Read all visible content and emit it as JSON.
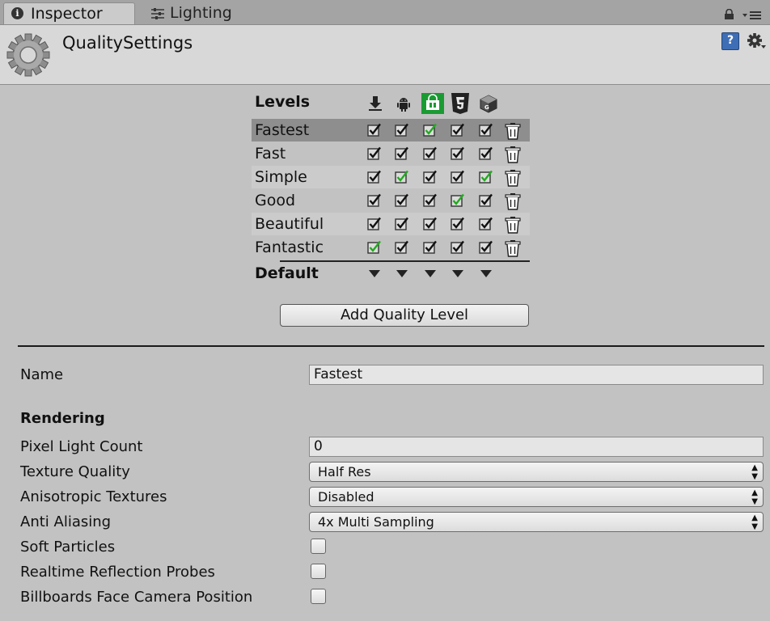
{
  "tabs": {
    "inspector": "Inspector",
    "lighting": "Lighting"
  },
  "header": {
    "title": "QualitySettings",
    "help_glyph": "?"
  },
  "levels": {
    "title": "Levels",
    "platform_icons": [
      "standalone-download-icon",
      "android-icon",
      "windows-store-icon",
      "html5-icon",
      "webgl-cube-icon"
    ],
    "rows": [
      {
        "name": "Fastest",
        "checks": [
          true,
          true,
          true,
          true,
          true
        ],
        "defaults": [
          false,
          false,
          true,
          false,
          false
        ],
        "selected": true
      },
      {
        "name": "Fast",
        "checks": [
          true,
          true,
          true,
          true,
          true
        ],
        "defaults": [
          false,
          false,
          false,
          false,
          false
        ]
      },
      {
        "name": "Simple",
        "checks": [
          true,
          true,
          true,
          true,
          true
        ],
        "defaults": [
          false,
          true,
          false,
          false,
          true
        ]
      },
      {
        "name": "Good",
        "checks": [
          true,
          true,
          true,
          true,
          true
        ],
        "defaults": [
          false,
          false,
          false,
          true,
          false
        ]
      },
      {
        "name": "Beautiful",
        "checks": [
          true,
          true,
          true,
          true,
          true
        ],
        "defaults": [
          false,
          false,
          false,
          false,
          false
        ]
      },
      {
        "name": "Fantastic",
        "checks": [
          true,
          true,
          true,
          true,
          true
        ],
        "defaults": [
          true,
          false,
          false,
          false,
          false
        ]
      }
    ],
    "default_label": "Default",
    "add_button": "Add Quality Level"
  },
  "properties": {
    "name_label": "Name",
    "name_value": "Fastest",
    "rendering_header": "Rendering",
    "pixel_light_count_label": "Pixel Light Count",
    "pixel_light_count_value": "0",
    "texture_quality_label": "Texture Quality",
    "texture_quality_value": "Half Res",
    "anisotropic_label": "Anisotropic Textures",
    "anisotropic_value": "Disabled",
    "anti_aliasing_label": "Anti Aliasing",
    "anti_aliasing_value": "4x Multi Sampling",
    "soft_particles_label": "Soft Particles",
    "soft_particles_checked": false,
    "realtime_reflection_label": "Realtime Reflection Probes",
    "realtime_reflection_checked": false,
    "billboards_label": "Billboards Face Camera Position",
    "billboards_checked": false
  },
  "colors": {
    "background": "#c2c2c2",
    "selected_row": "#8e8e8e",
    "default_check": "#22aa22",
    "accent_green": "#1a9b32"
  }
}
